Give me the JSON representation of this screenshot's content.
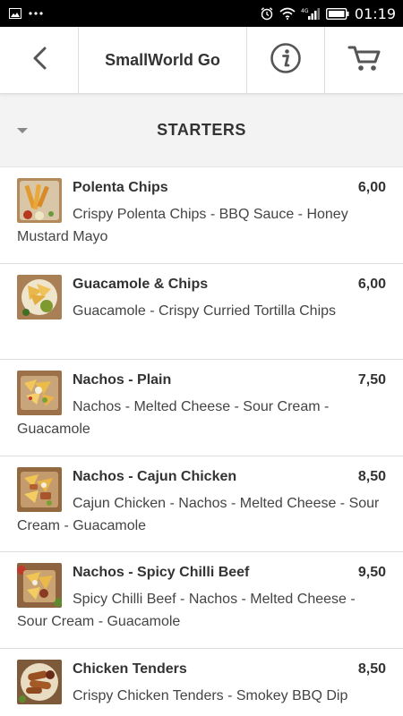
{
  "status_bar": {
    "time": "01:19",
    "left_icons": [
      "image-icon",
      "more-icon"
    ],
    "right_icons": [
      "alarm-icon",
      "wifi-icon",
      "signal-icon",
      "battery-icon"
    ],
    "network_label": "4G"
  },
  "header": {
    "title": "SmallWorld Go",
    "back_icon": "chevron-left-icon",
    "info_icon": "info-icon",
    "cart_icon": "cart-icon"
  },
  "category": {
    "title": "STARTERS"
  },
  "items": [
    {
      "name": "Polenta Chips",
      "price": "6,00",
      "description": "Crispy Polenta Chips - BBQ Sauce - Honey Mustard Mayo"
    },
    {
      "name": "Guacamole & Chips",
      "price": "6,00",
      "description": "Guacamole - Crispy Curried Tortilla Chips"
    },
    {
      "name": "Nachos - Plain",
      "price": "7,50",
      "description": "Nachos - Melted Cheese - Sour Cream - Guacamole"
    },
    {
      "name": "Nachos - Cajun Chicken",
      "price": "8,50",
      "description": "Cajun Chicken - Nachos - Melted Cheese - Sour Cream - Guacamole"
    },
    {
      "name": "Nachos - Spicy Chilli Beef",
      "price": "9,50",
      "description": "Spicy Chilli Beef - Nachos - Melted Cheese - Sour Cream - Guacamole"
    },
    {
      "name": "Chicken Tenders",
      "price": "8,50",
      "description": "Crispy Chicken Tenders - Smokey BBQ Dip"
    }
  ],
  "colors": {
    "status_bar_bg": "#000000",
    "header_bg": "#ffffff",
    "category_bg": "#f3f3f3",
    "divider": "#dddddd",
    "text": "#333333"
  }
}
